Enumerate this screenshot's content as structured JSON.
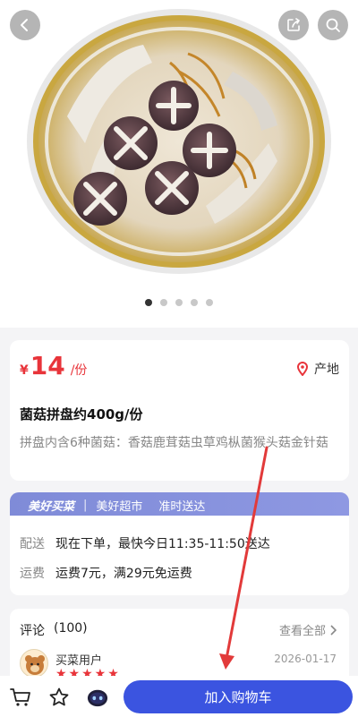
{
  "product": {
    "currency": "¥",
    "price": "14",
    "unit": "/份",
    "origin_label": "产地",
    "title": "菌菇拼盘约400g/份",
    "description": "拼盘内含6种菌菇：香菇鹿茸菇虫草鸡枞菌猴头菇金针菇"
  },
  "gallery": {
    "total_images": 5,
    "active_index": 0
  },
  "delivery": {
    "brand": "美好买菜",
    "store": "美好超市",
    "promise": "准时送达",
    "rows": [
      {
        "label": "配送",
        "value": "现在下单，最快今日11:35-11:50送达"
      },
      {
        "label": "运费",
        "value": "运费7元，满29元免运费"
      }
    ]
  },
  "reviews": {
    "label": "评论",
    "count": "(100)",
    "see_all": "查看全部",
    "first": {
      "user": "买菜用户",
      "date": "2026-01-17",
      "stars": "★★★★★"
    }
  },
  "bottom_bar": {
    "add_to_cart": "加入购物车"
  },
  "colors": {
    "accent_red": "#e8343a",
    "primary_blue": "#3b54e0",
    "banner_blue": "#8390dc"
  },
  "icons": [
    "back-icon",
    "share-icon",
    "search-icon",
    "location-pin-icon",
    "chevron-right-icon",
    "cart-icon",
    "favorite-star-icon",
    "assistant-robot-icon"
  ]
}
